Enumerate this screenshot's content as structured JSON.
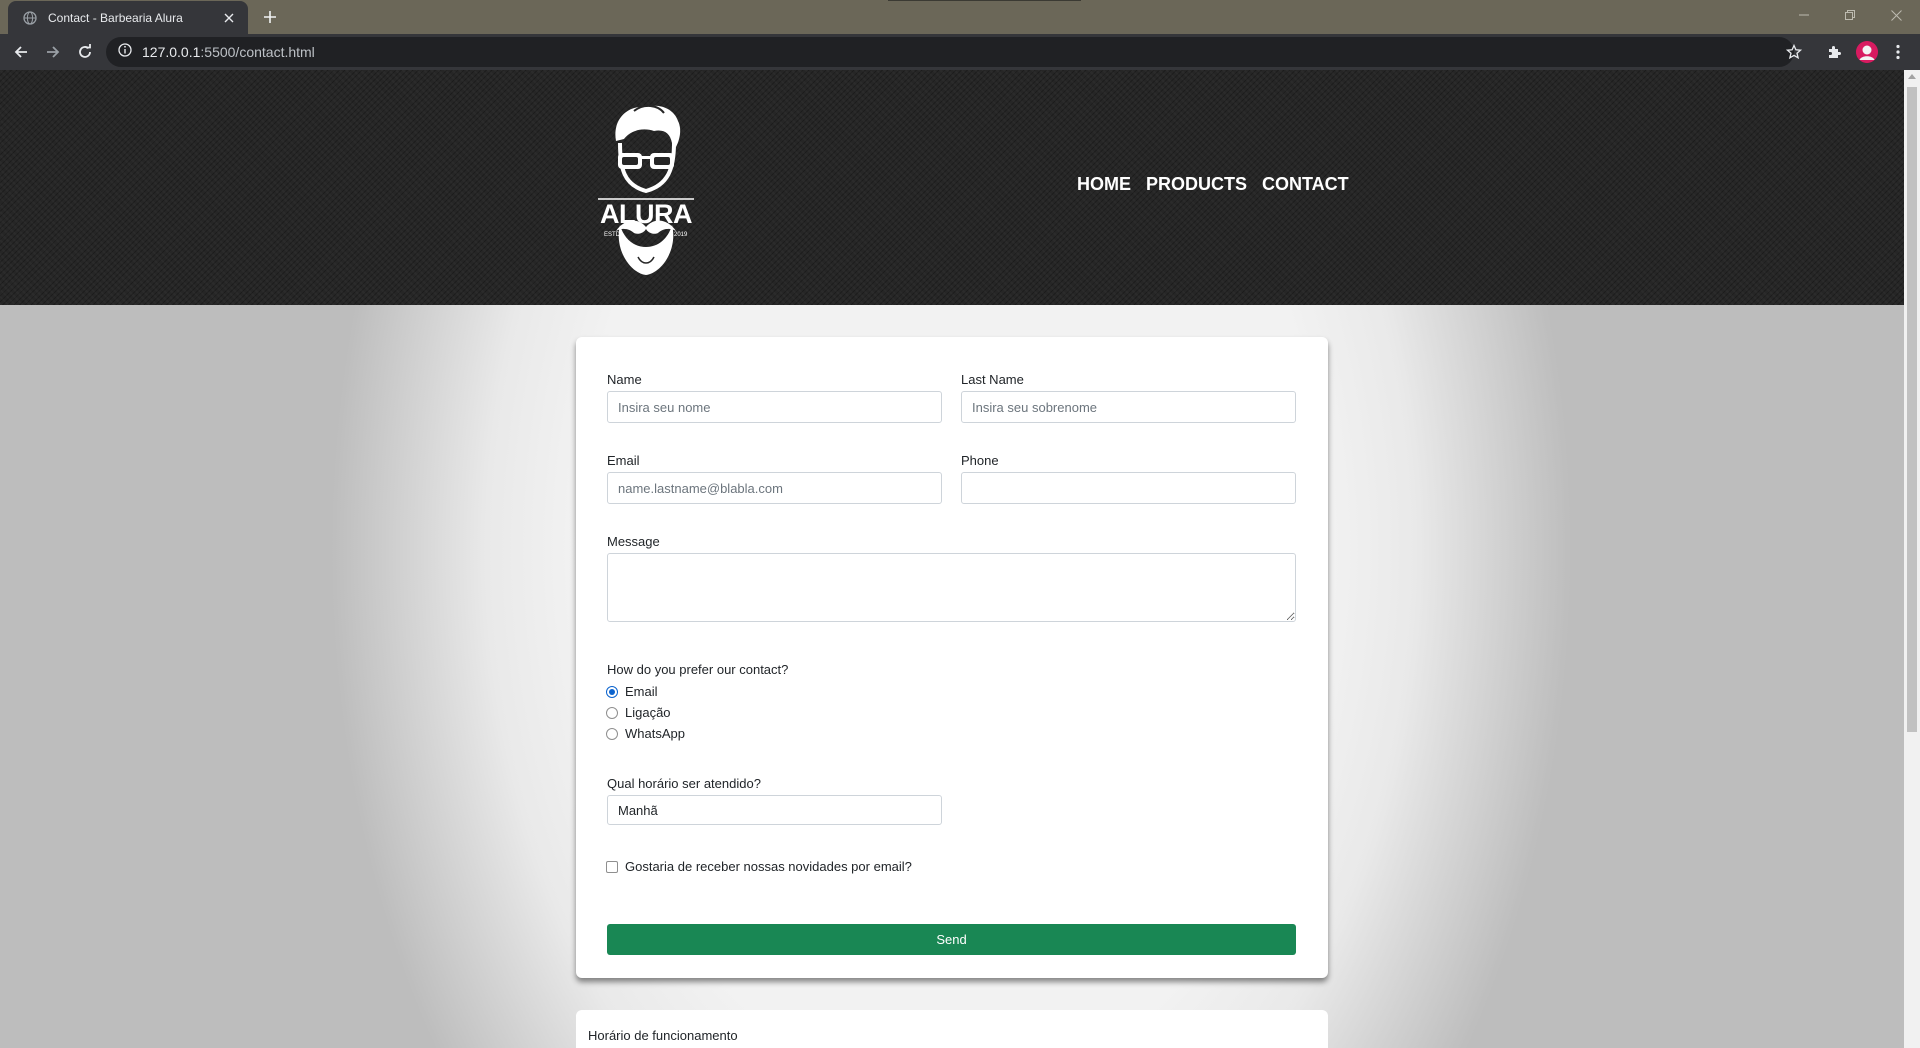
{
  "browser": {
    "tab_title": "Contact - Barbearia Alura",
    "url_host": "127.0.0.1",
    "url_rest": ":5500/contact.html"
  },
  "header": {
    "logo_text": "ALURA",
    "logo_estd": "ESTD",
    "logo_year": "2019",
    "nav": [
      "HOME",
      "PRODUCTS",
      "CONTACT"
    ]
  },
  "form": {
    "name_label": "Name",
    "name_placeholder": "Insira seu nome",
    "lastname_label": "Last Name",
    "lastname_placeholder": "Insira seu sobrenome",
    "email_label": "Email",
    "email_placeholder": "name.lastname@blabla.com",
    "phone_label": "Phone",
    "phone_placeholder": "",
    "message_label": "Message",
    "contact_pref_label": "How do you prefer our contact?",
    "contact_options": [
      "Email",
      "Ligação",
      "WhatsApp"
    ],
    "contact_selected": "Email",
    "schedule_label": "Qual horário ser atendido?",
    "schedule_value": "Manhã",
    "newsletter_label": "Gostaria de receber nossas novidades por email?",
    "newsletter_checked": false,
    "send_label": "Send"
  },
  "hours_card": {
    "title": "Horário de funcionamento"
  },
  "colors": {
    "send_button": "#198754",
    "radio_checked": "#0b63ce",
    "header_bg": "#262626"
  }
}
